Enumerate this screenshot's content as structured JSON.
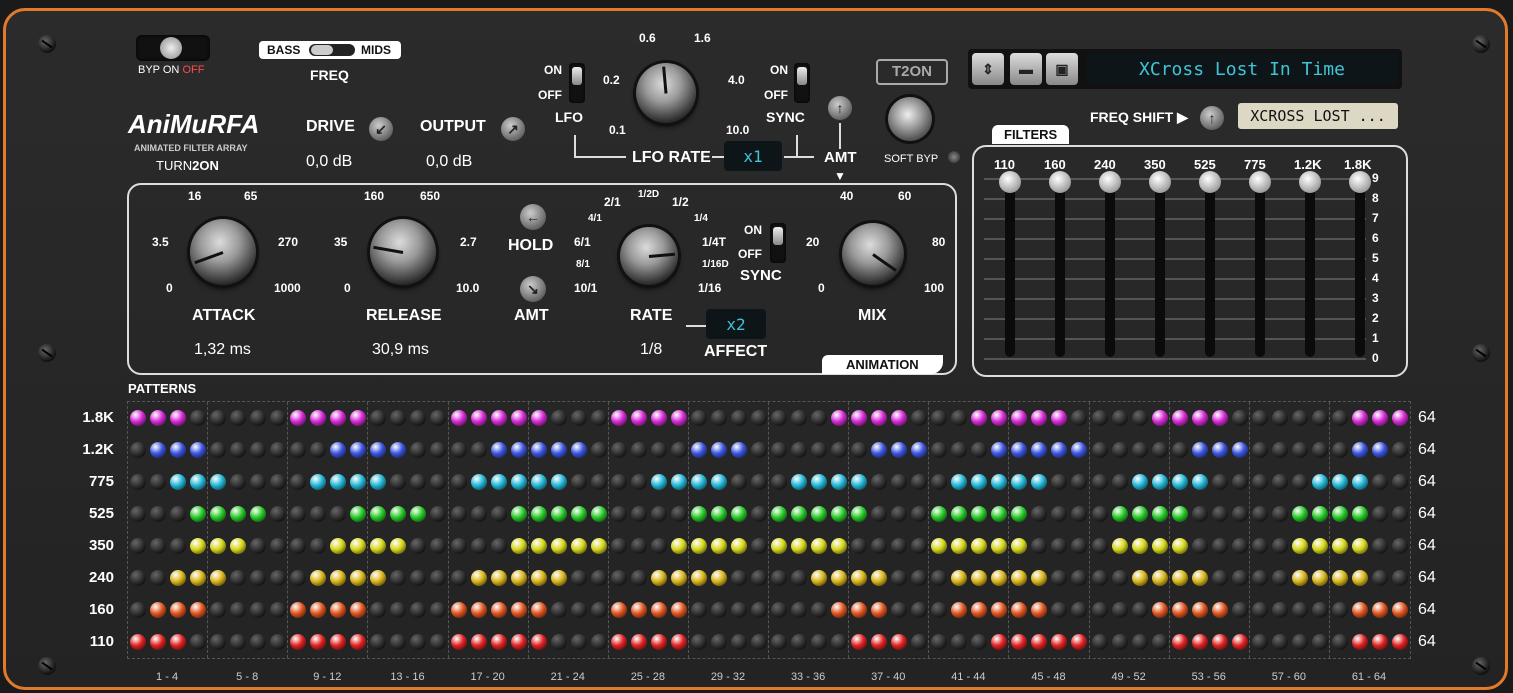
{
  "plugin": {
    "name": "AniMuRFA",
    "subtitle": "ANIMATED FILTER ARRAY",
    "brand_a": "TURN",
    "brand_b": "2ON",
    "logo": "T2ON"
  },
  "bypass": {
    "byp": "BYP",
    "on": "ON",
    "off": "OFF"
  },
  "freq": {
    "bass": "BASS",
    "mids": "MIDS",
    "label": "FREQ"
  },
  "drive": {
    "label": "DRIVE",
    "value": "0,0 dB"
  },
  "output": {
    "label": "OUTPUT",
    "value": "0,0 dB"
  },
  "lfo": {
    "on": "ON",
    "off": "OFF",
    "label": "LFO",
    "rate_label": "LFO RATE",
    "rate_mult": "x1",
    "ticks": [
      "0.1",
      "0.2",
      "0.6",
      "1.6",
      "4.0",
      "10.0"
    ]
  },
  "sync_top": {
    "on": "ON",
    "off": "OFF",
    "label": "SYNC"
  },
  "amt_top": {
    "label": "AMT"
  },
  "soft_byp": {
    "label": "SOFT BYP"
  },
  "preset": {
    "name": "XCross Lost In Time",
    "short": "XCROSS LOST ...",
    "freq_shift": "FREQ SHIFT ▶"
  },
  "attack": {
    "label": "ATTACK",
    "value": "1,32 ms",
    "ticks": [
      "0",
      "3.5",
      "16",
      "65",
      "270",
      "1000"
    ]
  },
  "release": {
    "label": "RELEASE",
    "value": "30,9 ms",
    "ticks": [
      "0",
      "35",
      "160",
      "650",
      "2.7",
      "10.0"
    ]
  },
  "hold": {
    "label": "HOLD"
  },
  "amt_mid": {
    "label": "AMT"
  },
  "rate": {
    "label": "RATE",
    "value": "1/8",
    "mult": "x2",
    "ticks": [
      "10/1",
      "8/1",
      "6/1",
      "4/1",
      "2/1",
      "1/2D",
      "1/2",
      "1/4",
      "1/4T",
      "1/16D",
      "1/16"
    ]
  },
  "sync_mid": {
    "on": "ON",
    "off": "OFF",
    "label": "SYNC"
  },
  "affect": {
    "label": "AFFECT"
  },
  "mix": {
    "label": "MIX",
    "ticks": [
      "0",
      "20",
      "40",
      "60",
      "80",
      "100"
    ]
  },
  "animation": {
    "label": "ANIMATION"
  },
  "filters": {
    "label": "FILTERS",
    "bands": [
      "110",
      "160",
      "240",
      "350",
      "525",
      "775",
      "1.2K",
      "1.8K"
    ],
    "scale": [
      "9",
      "8",
      "7",
      "6",
      "5",
      "4",
      "3",
      "2",
      "1",
      "0"
    ]
  },
  "patterns": {
    "label": "PATTERNS",
    "rows": [
      {
        "name": "1.8K",
        "color": "#d62bd6",
        "count": "64",
        "on": "1110000011110000111110001111000000011110001111100001111000000111"
      },
      {
        "name": "1.2K",
        "color": "#3b55e0",
        "count": "64",
        "on": "0111000000111100001111100000111000000111000111110000011100000110"
      },
      {
        "name": "775",
        "color": "#22b6d6",
        "count": "64",
        "on": "0011100001111000011111000011110001111000011111000011110000011100"
      },
      {
        "name": "525",
        "color": "#27c927",
        "count": "64",
        "on": "0001111000011110000111110000111011111000111110000111100000111100"
      },
      {
        "name": "350",
        "color": "#d6d61b",
        "count": "64",
        "on": "0001110000111100000111110001111011110000111110000111100000111100"
      },
      {
        "name": "240",
        "color": "#d9b51a",
        "count": "64",
        "on": "0011100001111000011111000011110000111100011111000011110000111100"
      },
      {
        "name": "160",
        "color": "#e0551f",
        "count": "64",
        "on": "0111000011110000111110001111000000011100011111000001111000000111"
      },
      {
        "name": "110",
        "color": "#e02222",
        "count": "64",
        "on": "1110000011110000111110001111000000001110000111110000111100000111"
      }
    ],
    "columns": [
      "1 - 4",
      "5 - 8",
      "9 - 12",
      "13 - 16",
      "17 - 20",
      "21 - 24",
      "25 - 28",
      "29 - 32",
      "33 - 36",
      "37 - 40",
      "41 - 44",
      "45 - 48",
      "49 - 52",
      "53 - 56",
      "57 - 60",
      "61 - 64"
    ]
  }
}
